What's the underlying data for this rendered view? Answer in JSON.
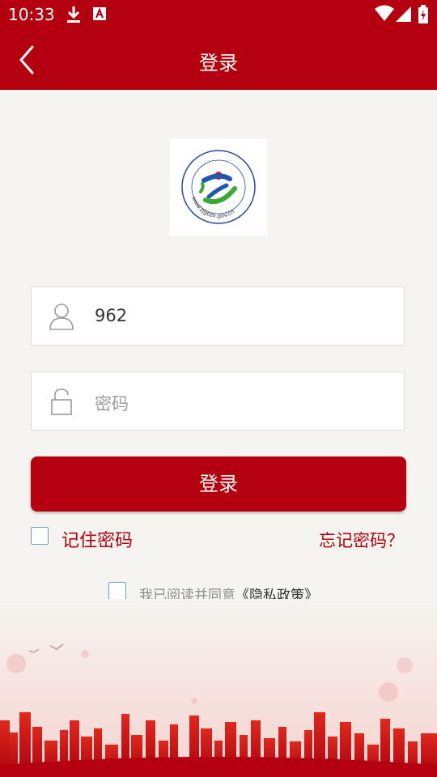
{
  "status_bar": {
    "time": "10:33"
  },
  "header": {
    "title": "登录"
  },
  "login_form": {
    "username_value": "962",
    "password_placeholder": "密码",
    "login_button_label": "登录",
    "remember_label": "记住密码",
    "forgot_label": "忘记密码？"
  },
  "agreement": {
    "text": "我已阅读并同意",
    "policy_link": "《隐私政策》"
  },
  "logo": {
    "url_text": "www.zjgbzx.gov.cn"
  },
  "colors": {
    "brand_red": "#b4000e",
    "background": "#f5f4f0",
    "checkbox_border": "#6a9bd8"
  }
}
